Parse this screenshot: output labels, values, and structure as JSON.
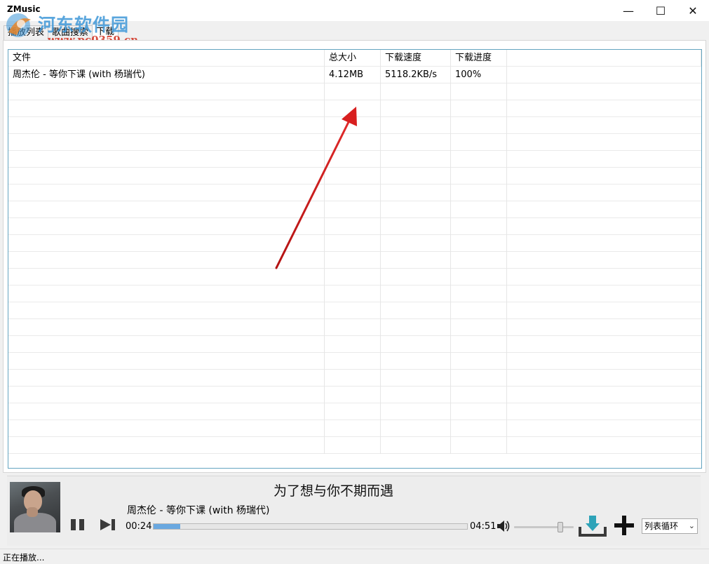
{
  "window": {
    "title": "ZMusic",
    "minimize_glyph": "—",
    "maximize_glyph": "☐",
    "close_glyph": "✕"
  },
  "watermark": {
    "text_line1": "河东软件园",
    "text_line2": "www.pc0359.cn"
  },
  "tabs": [
    {
      "label": "播放列表",
      "active": false
    },
    {
      "label": "歌曲搜索",
      "active": false
    },
    {
      "label": "下载",
      "active": true
    }
  ],
  "download_table": {
    "columns": [
      "文件",
      "总大小",
      "下载速度",
      "下载进度"
    ],
    "rows": [
      {
        "file": "周杰伦 - 等你下课 (with 杨瑞代)",
        "size": "4.12MB",
        "speed": "5118.2KB/s",
        "progress": "100%"
      }
    ]
  },
  "player": {
    "lyric": "为了想与你不期而遇",
    "song_title": "周杰伦 - 等你下课 (with 杨瑞代)",
    "current_time": "00:24",
    "total_time": "04:51",
    "progress_fraction": 0.085,
    "volume_fraction": 0.78,
    "loop_mode": "列表循环",
    "loop_arrow": "⌄",
    "accent_color": "#6aa8e0",
    "download_icon_color": "#2ea3b8"
  },
  "status": {
    "text": "正在播放..."
  }
}
